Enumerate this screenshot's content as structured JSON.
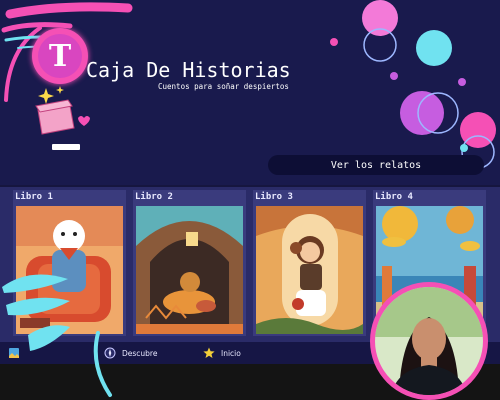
{
  "header": {
    "logo_letter": "T",
    "title": "Caja De Historias",
    "subtitle": "Cuentos para soñar despiertos",
    "view_button_label": "Ver los relatos"
  },
  "books": [
    {
      "label": "Libro 1"
    },
    {
      "label": "Libro 2"
    },
    {
      "label": "Libro 3"
    },
    {
      "label": "Libro 4"
    }
  ],
  "nav": {
    "discover_label": "Descubre",
    "home_label": "Inicio"
  },
  "colors": {
    "background": "#191a4d",
    "accent_pink": "#f550b5",
    "accent_cyan": "#70e2f0",
    "accent_purple": "#c65de0"
  }
}
